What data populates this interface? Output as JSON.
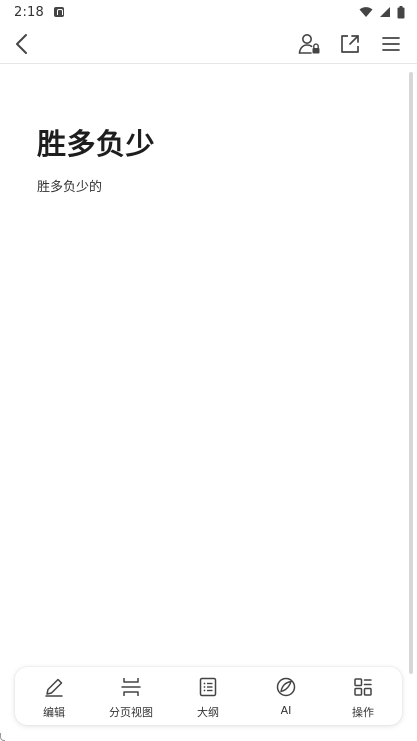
{
  "status_bar": {
    "time": "2:18",
    "icons": [
      "notification-icon",
      "wifi-icon",
      "signal-icon",
      "battery-icon"
    ]
  },
  "toolbar": {
    "back_icon": "back-icon",
    "actions": [
      "share-permission-icon",
      "export-icon",
      "menu-icon"
    ]
  },
  "document": {
    "title": "胜多负少",
    "body": "胜多负少的"
  },
  "bottom_bar": {
    "items": [
      {
        "label": "编辑",
        "icon": "edit-icon"
      },
      {
        "label": "分页视图",
        "icon": "page-view-icon"
      },
      {
        "label": "大纲",
        "icon": "outline-icon"
      },
      {
        "label": "AI",
        "icon": "ai-icon"
      },
      {
        "label": "操作",
        "icon": "operations-icon"
      }
    ]
  },
  "colors": {
    "background": "#ffffff",
    "text": "#1e1e1e",
    "icon": "#444444",
    "divider": "#e6e6e6"
  }
}
